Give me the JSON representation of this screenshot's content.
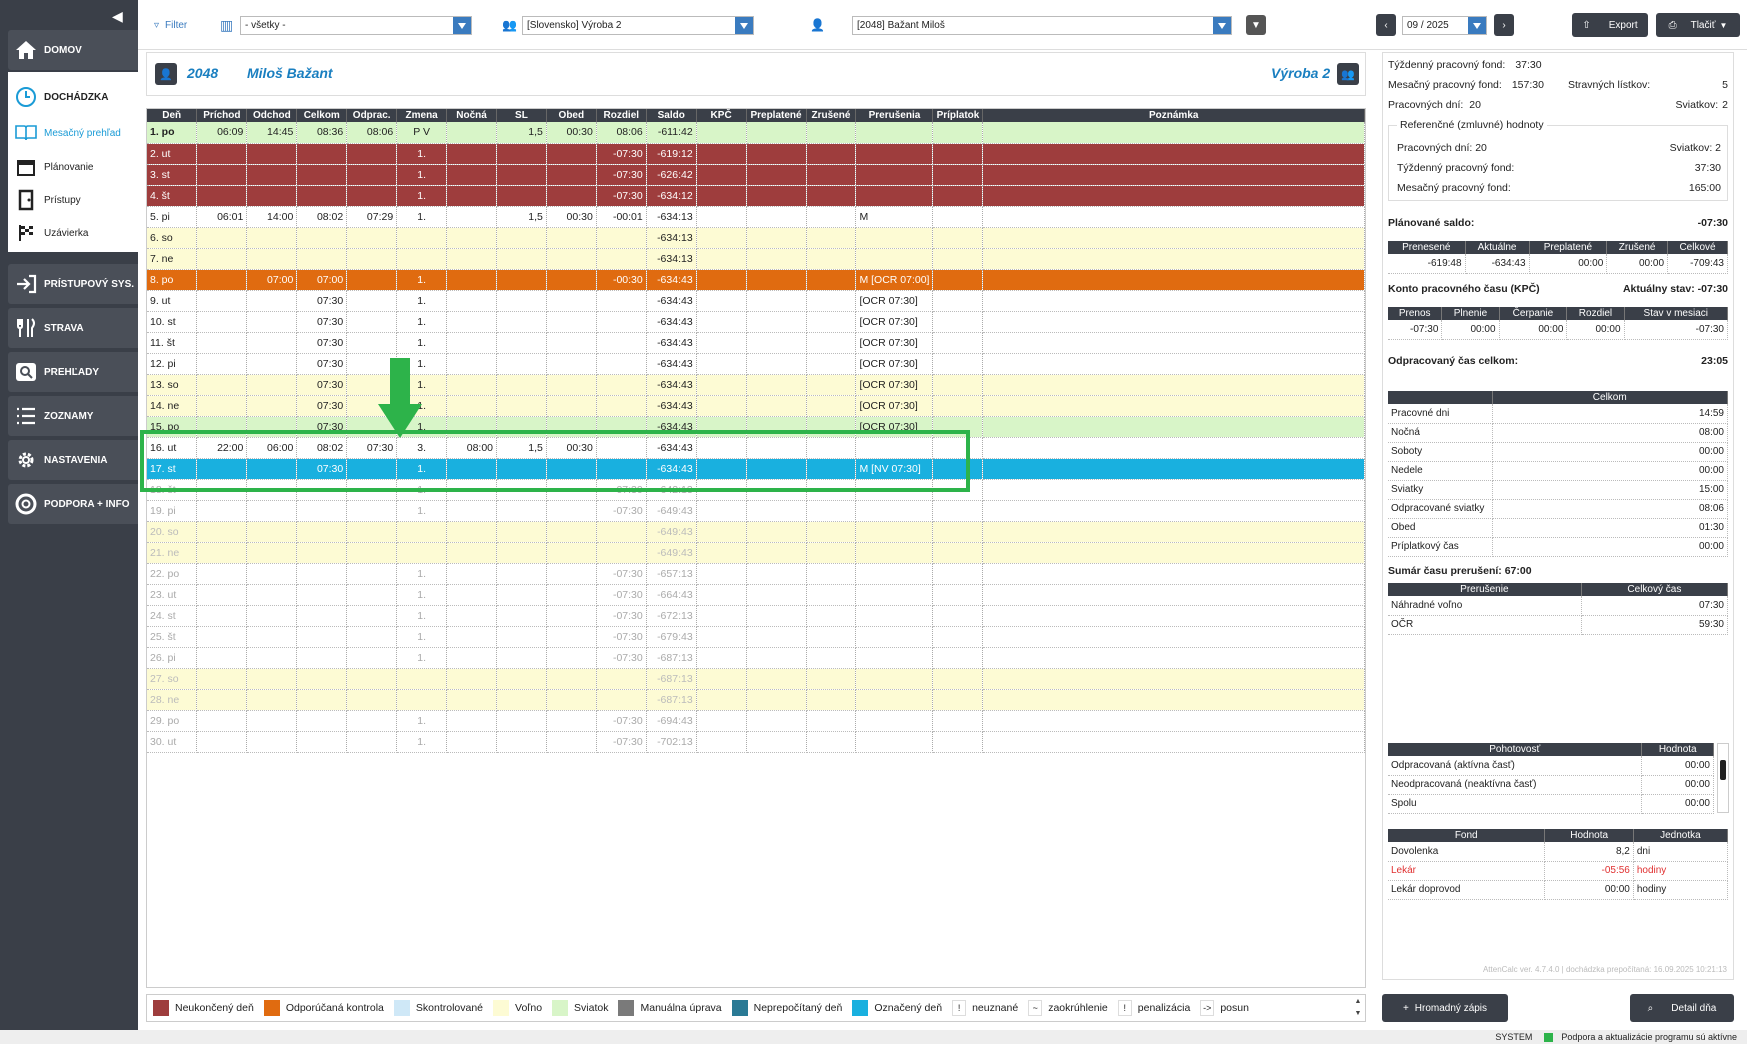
{
  "sidebar": {
    "items": [
      {
        "label": "DOMOV",
        "icon": "home-icon"
      },
      {
        "label": "DOCHÁDZKA",
        "icon": "clock-icon"
      },
      {
        "label": "PRÍSTUPOVÝ SYS.",
        "icon": "login-icon"
      },
      {
        "label": "STRAVA",
        "icon": "cutlery-icon"
      },
      {
        "label": "PREHĽADY",
        "icon": "search-icon"
      },
      {
        "label": "ZOZNAMY",
        "icon": "list-icon"
      },
      {
        "label": "NASTAVENIA",
        "icon": "gear-icon"
      },
      {
        "label": "PODPORA + INFO",
        "icon": "lifebuoy-icon"
      }
    ],
    "subitems": [
      {
        "label": "Mesačný prehľad",
        "icon": "book-icon"
      },
      {
        "label": "Plánovanie",
        "icon": "calendar-icon"
      },
      {
        "label": "Prístupy",
        "icon": "door-icon"
      },
      {
        "label": "Uzávierka",
        "icon": "flag-icon"
      }
    ]
  },
  "topbar": {
    "filter_label": "Filter",
    "group_value": "- všetky -",
    "dept_value": "[Slovensko] Výroba 2",
    "employee_value": "[2048] Bažant Miloš",
    "period": "09 / 2025",
    "export_label": "Export",
    "print_label": "Tlačiť"
  },
  "employee": {
    "id": "2048",
    "name": "Miloš Bažant",
    "dept": "Výroba 2"
  },
  "grid": {
    "headers": [
      "Deň",
      "Príchod",
      "Odchod",
      "Celkom",
      "Odprac.",
      "Zmena",
      "Nočná",
      "SL",
      "Obed",
      "Rozdiel",
      "Saldo",
      "KPČ",
      "Preplatené",
      "Zrušené",
      "Prerušenia",
      "Príplatok",
      "Poznámka"
    ],
    "rows": [
      {
        "t": "holiday",
        "c": [
          "1. po",
          "06:09",
          "14:45",
          "08:36",
          "08:06",
          "P V",
          "",
          "1,5",
          "00:30",
          "08:06",
          "-611:42",
          "",
          "",
          "",
          "",
          "",
          ""
        ]
      },
      {
        "t": "unfinished",
        "c": [
          "2. ut",
          "",
          "",
          "",
          "",
          "1.",
          "",
          "",
          "",
          "-07:30",
          "-619:12",
          "",
          "",
          "",
          "",
          "",
          ""
        ]
      },
      {
        "t": "unfinished",
        "c": [
          "3. st",
          "",
          "",
          "",
          "",
          "1.",
          "",
          "",
          "",
          "-07:30",
          "-626:42",
          "",
          "",
          "",
          "",
          "",
          ""
        ]
      },
      {
        "t": "unfinished",
        "c": [
          "4. št",
          "",
          "",
          "",
          "",
          "1.",
          "",
          "",
          "",
          "-07:30",
          "-634:12",
          "",
          "",
          "",
          "",
          "",
          ""
        ]
      },
      {
        "t": "normal",
        "c": [
          "5. pi",
          "06:01",
          "14:00",
          "08:02",
          "07:29",
          "1.",
          "",
          "1,5",
          "00:30",
          "-00:01",
          "-634:13",
          "",
          "",
          "",
          "M",
          "",
          ""
        ]
      },
      {
        "t": "free",
        "c": [
          "6. so",
          "",
          "",
          "",
          "",
          "",
          "",
          "",
          "",
          "",
          "-634:13",
          "",
          "",
          "",
          "",
          "",
          ""
        ]
      },
      {
        "t": "free",
        "c": [
          "7. ne",
          "",
          "",
          "",
          "",
          "",
          "",
          "",
          "",
          "",
          "-634:13",
          "",
          "",
          "",
          "",
          "",
          ""
        ]
      },
      {
        "t": "orange",
        "c": [
          "8. po",
          "",
          "07:00",
          "07:00",
          "",
          "1.",
          "",
          "",
          "",
          "-00:30",
          "-634:43",
          "",
          "",
          "",
          "M [OCR 07:00]",
          "",
          ""
        ]
      },
      {
        "t": "normal",
        "c": [
          "9. ut",
          "",
          "",
          "07:30",
          "",
          "1.",
          "",
          "",
          "",
          "",
          "-634:43",
          "",
          "",
          "",
          "[OCR 07:30]",
          "",
          ""
        ]
      },
      {
        "t": "normal",
        "c": [
          "10. st",
          "",
          "",
          "07:30",
          "",
          "1.",
          "",
          "",
          "",
          "",
          "-634:43",
          "",
          "",
          "",
          "[OCR 07:30]",
          "",
          ""
        ]
      },
      {
        "t": "normal",
        "c": [
          "11. št",
          "",
          "",
          "07:30",
          "",
          "1.",
          "",
          "",
          "",
          "",
          "-634:43",
          "",
          "",
          "",
          "[OCR 07:30]",
          "",
          ""
        ]
      },
      {
        "t": "normal",
        "c": [
          "12. pi",
          "",
          "",
          "07:30",
          "",
          "1.",
          "",
          "",
          "",
          "",
          "-634:43",
          "",
          "",
          "",
          "[OCR 07:30]",
          "",
          ""
        ]
      },
      {
        "t": "free",
        "c": [
          "13. so",
          "",
          "",
          "07:30",
          "",
          "1.",
          "",
          "",
          "",
          "",
          "-634:43",
          "",
          "",
          "",
          "[OCR 07:30]",
          "",
          ""
        ]
      },
      {
        "t": "free",
        "c": [
          "14. ne",
          "",
          "",
          "07:30",
          "",
          "1.",
          "",
          "",
          "",
          "",
          "-634:43",
          "",
          "",
          "",
          "[OCR 07:30]",
          "",
          ""
        ]
      },
      {
        "t": "holiday",
        "c": [
          "15. po",
          "",
          "",
          "07:30",
          "",
          "1.",
          "",
          "",
          "",
          "",
          "-634:43",
          "",
          "",
          "",
          "[OCR 07:30]",
          "",
          ""
        ]
      },
      {
        "t": "normal",
        "c": [
          "16. ut",
          "22:00",
          "06:00",
          "08:02",
          "07:30",
          "3.",
          "08:00",
          "1,5",
          "00:30",
          "",
          "-634:43",
          "",
          "",
          "",
          "",
          "",
          ""
        ]
      },
      {
        "t": "marked",
        "c": [
          "17. st",
          "",
          "",
          "07:30",
          "",
          "1.",
          "",
          "",
          "",
          "",
          "-634:43",
          "",
          "",
          "",
          "M [NV 07:30]",
          "",
          ""
        ]
      },
      {
        "t": "future",
        "c": [
          "18. št",
          "",
          "",
          "",
          "",
          "1.",
          "",
          "",
          "",
          "-07:30",
          "-642:13",
          "",
          "",
          "",
          "",
          "",
          ""
        ]
      },
      {
        "t": "future",
        "c": [
          "19. pi",
          "",
          "",
          "",
          "",
          "1.",
          "",
          "",
          "",
          "-07:30",
          "-649:43",
          "",
          "",
          "",
          "",
          "",
          ""
        ]
      },
      {
        "t": "free future",
        "c": [
          "20. so",
          "",
          "",
          "",
          "",
          "",
          "",
          "",
          "",
          "",
          "-649:43",
          "",
          "",
          "",
          "",
          "",
          ""
        ]
      },
      {
        "t": "free future",
        "c": [
          "21. ne",
          "",
          "",
          "",
          "",
          "",
          "",
          "",
          "",
          "",
          "-649:43",
          "",
          "",
          "",
          "",
          "",
          ""
        ]
      },
      {
        "t": "future",
        "c": [
          "22. po",
          "",
          "",
          "",
          "",
          "1.",
          "",
          "",
          "",
          "-07:30",
          "-657:13",
          "",
          "",
          "",
          "",
          "",
          ""
        ]
      },
      {
        "t": "future",
        "c": [
          "23. ut",
          "",
          "",
          "",
          "",
          "1.",
          "",
          "",
          "",
          "-07:30",
          "-664:43",
          "",
          "",
          "",
          "",
          "",
          ""
        ]
      },
      {
        "t": "future",
        "c": [
          "24. st",
          "",
          "",
          "",
          "",
          "1.",
          "",
          "",
          "",
          "-07:30",
          "-672:13",
          "",
          "",
          "",
          "",
          "",
          ""
        ]
      },
      {
        "t": "future",
        "c": [
          "25. št",
          "",
          "",
          "",
          "",
          "1.",
          "",
          "",
          "",
          "-07:30",
          "-679:43",
          "",
          "",
          "",
          "",
          "",
          ""
        ]
      },
      {
        "t": "future",
        "c": [
          "26. pi",
          "",
          "",
          "",
          "",
          "1.",
          "",
          "",
          "",
          "-07:30",
          "-687:13",
          "",
          "",
          "",
          "",
          "",
          ""
        ]
      },
      {
        "t": "free future",
        "c": [
          "27. so",
          "",
          "",
          "",
          "",
          "",
          "",
          "",
          "",
          "",
          "-687:13",
          "",
          "",
          "",
          "",
          "",
          ""
        ]
      },
      {
        "t": "free future",
        "c": [
          "28. ne",
          "",
          "",
          "",
          "",
          "",
          "",
          "",
          "",
          "",
          "-687:13",
          "",
          "",
          "",
          "",
          "",
          ""
        ]
      },
      {
        "t": "future",
        "c": [
          "29. po",
          "",
          "",
          "",
          "",
          "1.",
          "",
          "",
          "",
          "-07:30",
          "-694:43",
          "",
          "",
          "",
          "",
          "",
          ""
        ]
      },
      {
        "t": "future",
        "c": [
          "30. ut",
          "",
          "",
          "",
          "",
          "1.",
          "",
          "",
          "",
          "-07:30",
          "-702:13",
          "",
          "",
          "",
          "",
          "",
          ""
        ]
      }
    ]
  },
  "legend": [
    {
      "kind": "color",
      "color": "#9e3d3d",
      "label": "Neukončený deň"
    },
    {
      "kind": "color",
      "color": "#e06b10",
      "label": "Odporúčaná kontrola"
    },
    {
      "kind": "color",
      "color": "#cfe8f7",
      "label": "Skontrolované"
    },
    {
      "kind": "color",
      "color": "#fdfbd4",
      "label": "Voľno"
    },
    {
      "kind": "color",
      "color": "#d8f5c8",
      "label": "Sviatok"
    },
    {
      "kind": "color",
      "color": "#7a7a7a",
      "label": "Manuálna úprava"
    },
    {
      "kind": "color",
      "color": "#2a7a95",
      "label": "Neprepočítaný deň"
    },
    {
      "kind": "color",
      "color": "#19b0df",
      "label": "Označený deň"
    },
    {
      "kind": "sym",
      "sym": "!",
      "label": "neuznané"
    },
    {
      "kind": "sym",
      "sym": "~",
      "label": "zaokrúhlenie"
    },
    {
      "kind": "sym",
      "sym": "!",
      "label": "penalizácia"
    },
    {
      "kind": "sym",
      "sym": "->",
      "label": "posun"
    }
  ],
  "right": {
    "tyzdenny_fond_label": "Týždenný pracovný fond:",
    "tyzdenny_fond": "37:30",
    "mesacny_fond_label": "Mesačný pracovný fond:",
    "mesacny_fond": "157:30",
    "stravne_label": "Stravných lístkov:",
    "stravne": "5",
    "prac_dni_label": "Pracovných dní:",
    "prac_dni": "20",
    "sviatky_label": "Sviatkov:",
    "sviatky": "2",
    "ref_title": "Referenčné (zmluvné) hodnoty",
    "ref_prac_dni": "Pracovných dní: 20",
    "ref_sviatky": "Sviatkov: 2",
    "ref_tyzden_label": "Týždenný pracovný fond:",
    "ref_tyzden": "37:30",
    "ref_mesiac_label": "Mesačný pracovný fond:",
    "ref_mesiac": "165:00",
    "plan_saldo_label": "Plánované saldo:",
    "plan_saldo": "-07:30",
    "saldo_headers": [
      "Prenesené",
      "Aktuálne",
      "Preplatené",
      "Zrušené",
      "Celkové"
    ],
    "saldo_values": [
      "-619:48",
      "-634:43",
      "00:00",
      "00:00",
      "-709:43"
    ],
    "kpc_label": "Konto pracovného času (KPČ)",
    "kpc_state": "Aktuálny stav: -07:30",
    "kpc_headers": [
      "Prenos",
      "Plnenie",
      "Čerpanie",
      "Rozdiel",
      "Stav v mesiaci"
    ],
    "kpc_values": [
      "-07:30",
      "00:00",
      "00:00",
      "00:00",
      "-07:30"
    ],
    "odprac_label": "Odpracovaný čas celkom:",
    "odprac": "23:05",
    "celkom_header": "Celkom",
    "celkom_rows": [
      [
        "Pracovné dni",
        "14:59"
      ],
      [
        "Nočná",
        "08:00"
      ],
      [
        "Soboty",
        "00:00"
      ],
      [
        "Nedele",
        "00:00"
      ],
      [
        "Sviatky",
        "15:00"
      ],
      [
        "Odpracované sviatky",
        "08:06"
      ],
      [
        "Obed",
        "01:30"
      ],
      [
        "Príplatkový čas",
        "00:00"
      ]
    ],
    "prerus_label": "Sumár času prerušení: 67:00",
    "prerus_headers": [
      "Prerušenie",
      "Celkový čas"
    ],
    "prerus_rows": [
      [
        "Náhradné voľno",
        "07:30"
      ],
      [
        "OČR",
        "59:30"
      ]
    ],
    "poh_headers": [
      "Pohotovosť",
      "Hodnota"
    ],
    "poh_rows": [
      [
        "Odpracovaná (aktívna časť)",
        "00:00"
      ],
      [
        "Neodpracovaná (neaktívna časť)",
        "00:00"
      ],
      [
        "Spolu",
        "00:00"
      ]
    ],
    "fond_headers": [
      "Fond",
      "Hodnota",
      "Jednotka"
    ],
    "fond_rows": [
      [
        "Dovolenka",
        "8,2",
        "dni"
      ],
      [
        "Lekár",
        "-05:56",
        "hodiny"
      ],
      [
        "Lekár doprovod",
        "00:00",
        "hodiny"
      ]
    ],
    "version": "AttenCalc ver. 4.7.4.0 | dochádzka prepočítaná: 16.09.2025 10:21:13",
    "hromadny_label": "Hromadný zápis",
    "detail_label": "Detail dňa"
  },
  "status": {
    "user": "SYSTEM",
    "msg": "Podpora a aktualizácie programu sú aktívne"
  }
}
